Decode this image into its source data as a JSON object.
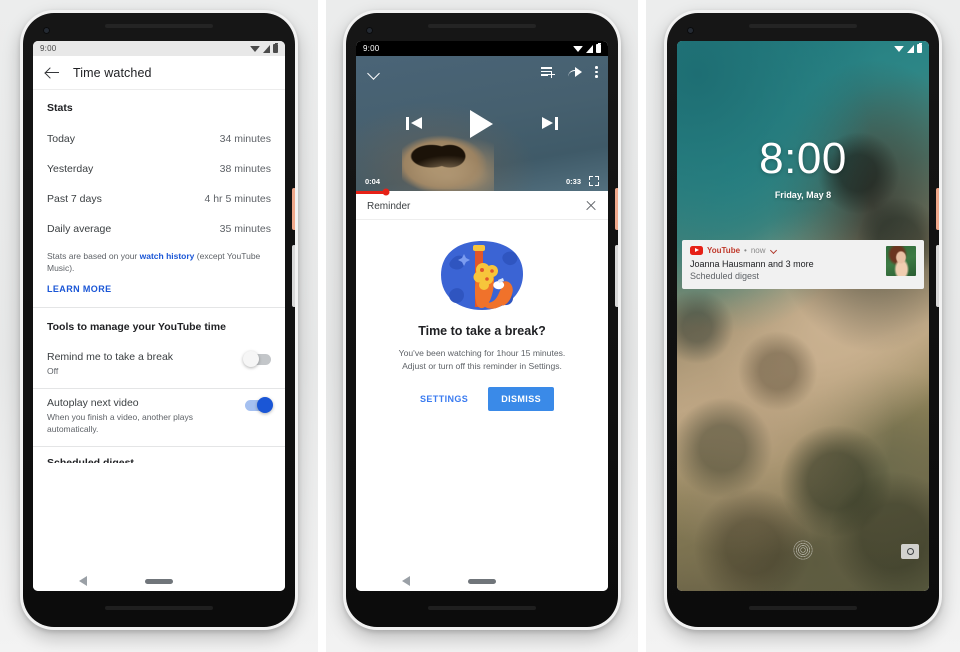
{
  "phone1": {
    "statusbar": {
      "time": "9:00",
      "icons": [
        "wifi-icon",
        "signal-icon",
        "battery-icon"
      ]
    },
    "appbar": {
      "back": "back-arrow-icon",
      "title": "Time watched"
    },
    "stats_heading": "Stats",
    "stats": [
      {
        "label": "Today",
        "value": "34 minutes"
      },
      {
        "label": "Yesterday",
        "value": "38 minutes"
      },
      {
        "label": "Past 7 days",
        "value": "4 hr 5 minutes"
      },
      {
        "label": "Daily average",
        "value": "35 minutes"
      }
    ],
    "note_before": "Stats are based on your ",
    "note_link": "watch history",
    "note_after": " (except YouTube Music).",
    "learn_more": "LEARN MORE",
    "tools_heading": "Tools to manage your YouTube time",
    "tools": [
      {
        "title": "Remind me to take a break",
        "subtitle": "Off",
        "toggle": "off"
      },
      {
        "title": "Autoplay next video",
        "subtitle": "When you finish a video, another plays automatically.",
        "toggle": "on"
      }
    ],
    "cutoff_item": "Scheduled digest",
    "navbar": {
      "back": "nav-back-icon",
      "home": "nav-home-pill"
    }
  },
  "phone2": {
    "statusbar": {
      "time": "9:00",
      "icons": [
        "wifi-icon",
        "signal-icon",
        "battery-icon"
      ]
    },
    "player": {
      "collapse": "chevron-down-icon",
      "queue": "add-to-queue-icon",
      "share": "share-icon",
      "more": "overflow-menu-icon",
      "previous": "previous-track-icon",
      "play": "play-icon",
      "next": "next-track-icon",
      "current_time": "0:04",
      "duration": "0:33",
      "fullscreen": "fullscreen-icon",
      "progress_percent": 12,
      "progress_color": "#e62117"
    },
    "sheet": {
      "title": "Reminder",
      "close": "close-icon"
    },
    "dialog": {
      "illustration": "monkey-on-pole-illustration",
      "title": "Time to take a break?",
      "body_line1": "You've been watching for 1hour 15 minutes.",
      "body_line2": "Adjust or turn off this reminder in Settings.",
      "secondary_action": "SETTINGS",
      "primary_action": "DISMISS",
      "primary_color": "#3a8ae8"
    },
    "navbar": {
      "back": "nav-back-icon",
      "home": "nav-home-pill"
    }
  },
  "phone3": {
    "statusbar": {
      "icons": [
        "wifi-icon",
        "signal-icon",
        "battery-icon"
      ]
    },
    "lock": {
      "time": "8:00",
      "date": "Friday, May 8"
    },
    "notification": {
      "app_icon": "youtube-icon",
      "app_name": "YouTube",
      "separator": "•",
      "time": "now",
      "expand": "chevron-down-icon",
      "title": "Joanna Hausmann and 3 more",
      "subtitle": "Scheduled digest",
      "thumbnail": "channel-avatar"
    },
    "fingerprint": "fingerprint-icon",
    "camera_shortcut": "camera-icon"
  }
}
